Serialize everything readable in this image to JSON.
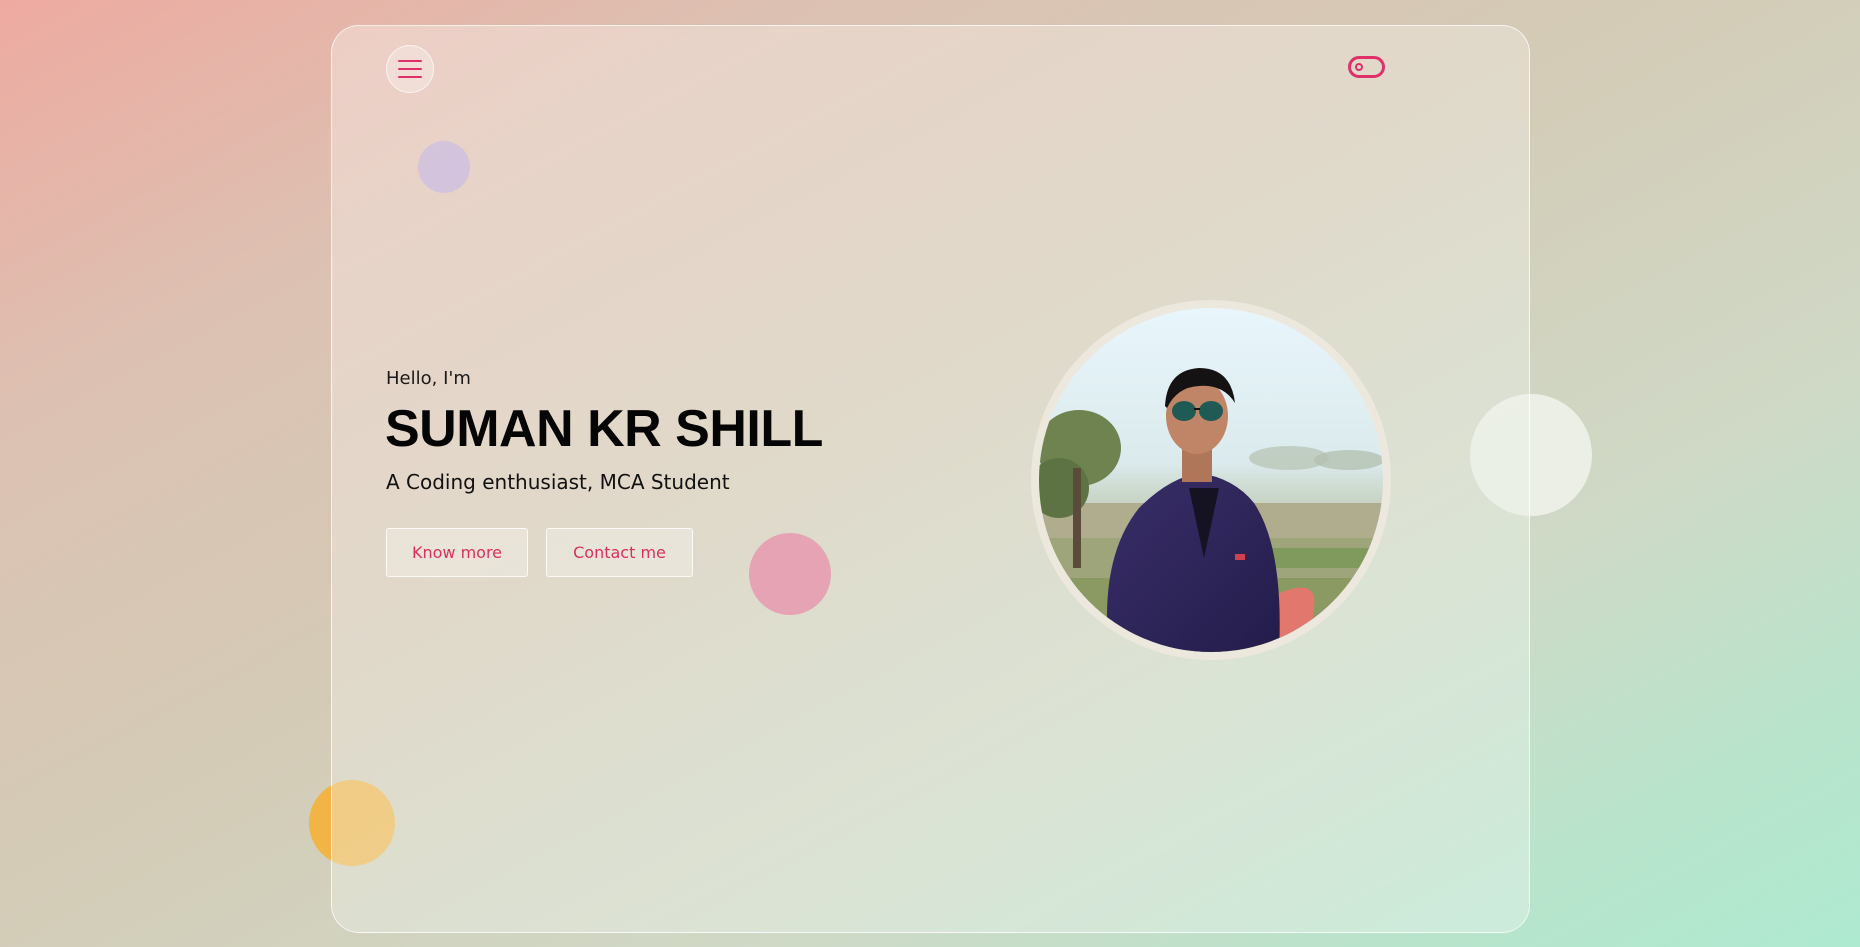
{
  "header": {
    "menu_icon": "hamburger-menu-icon",
    "theme_toggle_icon": "toggle-switch-icon"
  },
  "hero": {
    "greeting": "Hello, I'm",
    "name": "SUMAN KR SHILL",
    "tagline": "A Coding enthusiast, MCA Student",
    "buttons": {
      "know_more": "Know more",
      "contact_me": "Contact me"
    }
  },
  "colors": {
    "accent": "#e0306a",
    "text": "#050505"
  }
}
